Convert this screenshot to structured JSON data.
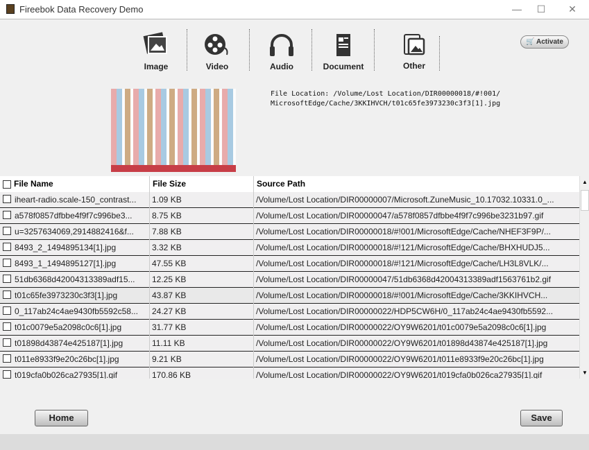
{
  "window": {
    "title": "Fireebok Data Recovery Demo",
    "minimize": "—",
    "maximize": "☐",
    "close": "✕"
  },
  "toolbar": {
    "items": [
      {
        "label": "Image",
        "icon": "image-icon"
      },
      {
        "label": "Video",
        "icon": "film-reel-icon"
      },
      {
        "label": "Audio",
        "icon": "headphones-icon"
      },
      {
        "label": "Document",
        "icon": "document-icon"
      },
      {
        "label": "Other",
        "icon": "other-files-icon"
      }
    ],
    "activate_label": "Activate"
  },
  "preview": {
    "location_line1": "File Location: /Volume/Lost Location/DIR00000018/#!001/",
    "location_line2": "MicrosoftEdge/Cache/3KKIHVCH/t01c65fe3973230c3f3[1].jpg"
  },
  "table": {
    "headers": {
      "name": "File Name",
      "size": "File Size",
      "path": "Source Path"
    },
    "rows": [
      {
        "name": "iheart-radio.scale-150_contrast...",
        "size": "1.09 KB",
        "path": "/Volume/Lost Location/DIR00000007/Microsoft.ZuneMusic_10.17032.10331.0_..."
      },
      {
        "name": "a578f0857dfbbe4f9f7c996be3...",
        "size": "8.75 KB",
        "path": "/Volume/Lost Location/DIR00000047/a578f0857dfbbe4f9f7c996be3231b97.gif"
      },
      {
        "name": "u=3257634069,2914882416&f...",
        "size": "7.88 KB",
        "path": "/Volume/Lost Location/DIR00000018/#!001/MicrosoftEdge/Cache/NHEF3F9P/..."
      },
      {
        "name": "8493_2_1494895134[1].jpg",
        "size": "3.32 KB",
        "path": "/Volume/Lost Location/DIR00000018/#!121/MicrosoftEdge/Cache/BHXHUDJ5..."
      },
      {
        "name": "8493_1_1494895127[1].jpg",
        "size": "47.55 KB",
        "path": "/Volume/Lost Location/DIR00000018/#!121/MicrosoftEdge/Cache/LH3L8VLK/..."
      },
      {
        "name": "51db6368d42004313389adf15...",
        "size": "12.25 KB",
        "path": "/Volume/Lost Location/DIR00000047/51db6368d42004313389adf1563761b2.gif"
      },
      {
        "name": "t01c65fe3973230c3f3[1].jpg",
        "size": "43.87 KB",
        "path": "/Volume/Lost Location/DIR00000018/#!001/MicrosoftEdge/Cache/3KKIHVCH...",
        "selected": true
      },
      {
        "name": "0_117ab24c4ae9430fb5592c58...",
        "size": "24.27 KB",
        "path": "/Volume/Lost Location/DIR00000022/HDP5CW6H/0_117ab24c4ae9430fb5592..."
      },
      {
        "name": "t01c0079e5a2098c0c6[1].jpg",
        "size": "31.77 KB",
        "path": "/Volume/Lost Location/DIR00000022/OY9W6201/t01c0079e5a2098c0c6[1].jpg"
      },
      {
        "name": "t01898d43874e425187[1].jpg",
        "size": "11.11 KB",
        "path": "/Volume/Lost Location/DIR00000022/OY9W6201/t01898d43874e425187[1].jpg"
      },
      {
        "name": "t011e8933f9e20c26bc[1].jpg",
        "size": "9.21 KB",
        "path": "/Volume/Lost Location/DIR00000022/OY9W6201/t011e8933f9e20c26bc[1].jpg"
      },
      {
        "name": "t019cfa0b026ca27935[1].gif",
        "size": "170.86 KB",
        "path": "/Volume/Lost Location/DIR00000022/OY9W6201/t019cfa0b026ca27935[1].gif"
      }
    ]
  },
  "buttons": {
    "home": "Home",
    "save": "Save"
  }
}
